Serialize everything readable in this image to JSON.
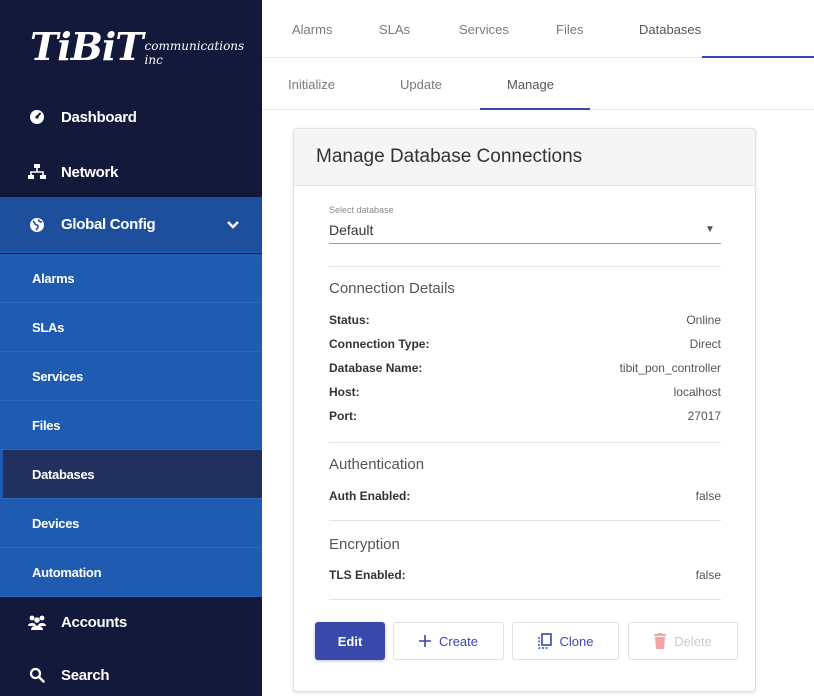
{
  "logo": {
    "main": "TiBiT",
    "sub": "communications inc"
  },
  "sidebar": {
    "top_items": [
      {
        "label": "Dashboard",
        "icon": "dashboard-icon"
      },
      {
        "label": "Network",
        "icon": "network-icon"
      },
      {
        "label": "Global Config",
        "icon": "globe-icon"
      }
    ],
    "sub_items": [
      "Alarms",
      "SLAs",
      "Services",
      "Files",
      "Databases",
      "Devices",
      "Automation"
    ],
    "active_sub": "Databases",
    "bottom_items": [
      {
        "label": "Accounts",
        "icon": "accounts-icon"
      },
      {
        "label": "Search",
        "icon": "search-icon"
      }
    ]
  },
  "tabs": {
    "primary": [
      "Alarms",
      "SLAs",
      "Services",
      "Files",
      "Databases"
    ],
    "primary_active": "Databases",
    "secondary": [
      "Initialize",
      "Update",
      "Manage"
    ],
    "secondary_active": "Manage"
  },
  "card": {
    "title": "Manage Database Connections",
    "select": {
      "label": "Select database",
      "value": "Default"
    },
    "connection": {
      "title": "Connection Details",
      "rows": [
        {
          "label": "Status:",
          "value": "Online"
        },
        {
          "label": "Connection Type:",
          "value": "Direct"
        },
        {
          "label": "Database Name:",
          "value": "tibit_pon_controller"
        },
        {
          "label": "Host:",
          "value": "localhost"
        },
        {
          "label": "Port:",
          "value": "27017"
        }
      ]
    },
    "authentication": {
      "title": "Authentication",
      "label": "Auth Enabled:",
      "value": "false"
    },
    "encryption": {
      "title": "Encryption",
      "label": "TLS Enabled:",
      "value": "false"
    },
    "buttons": {
      "edit": "Edit",
      "create": "Create",
      "clone": "Clone",
      "delete": "Delete"
    }
  },
  "colors": {
    "sidebar_bg": "#13193a",
    "submenu_bg": "#1f5bb0",
    "active_sub_bg": "#21305f",
    "accent": "#3949ab"
  }
}
